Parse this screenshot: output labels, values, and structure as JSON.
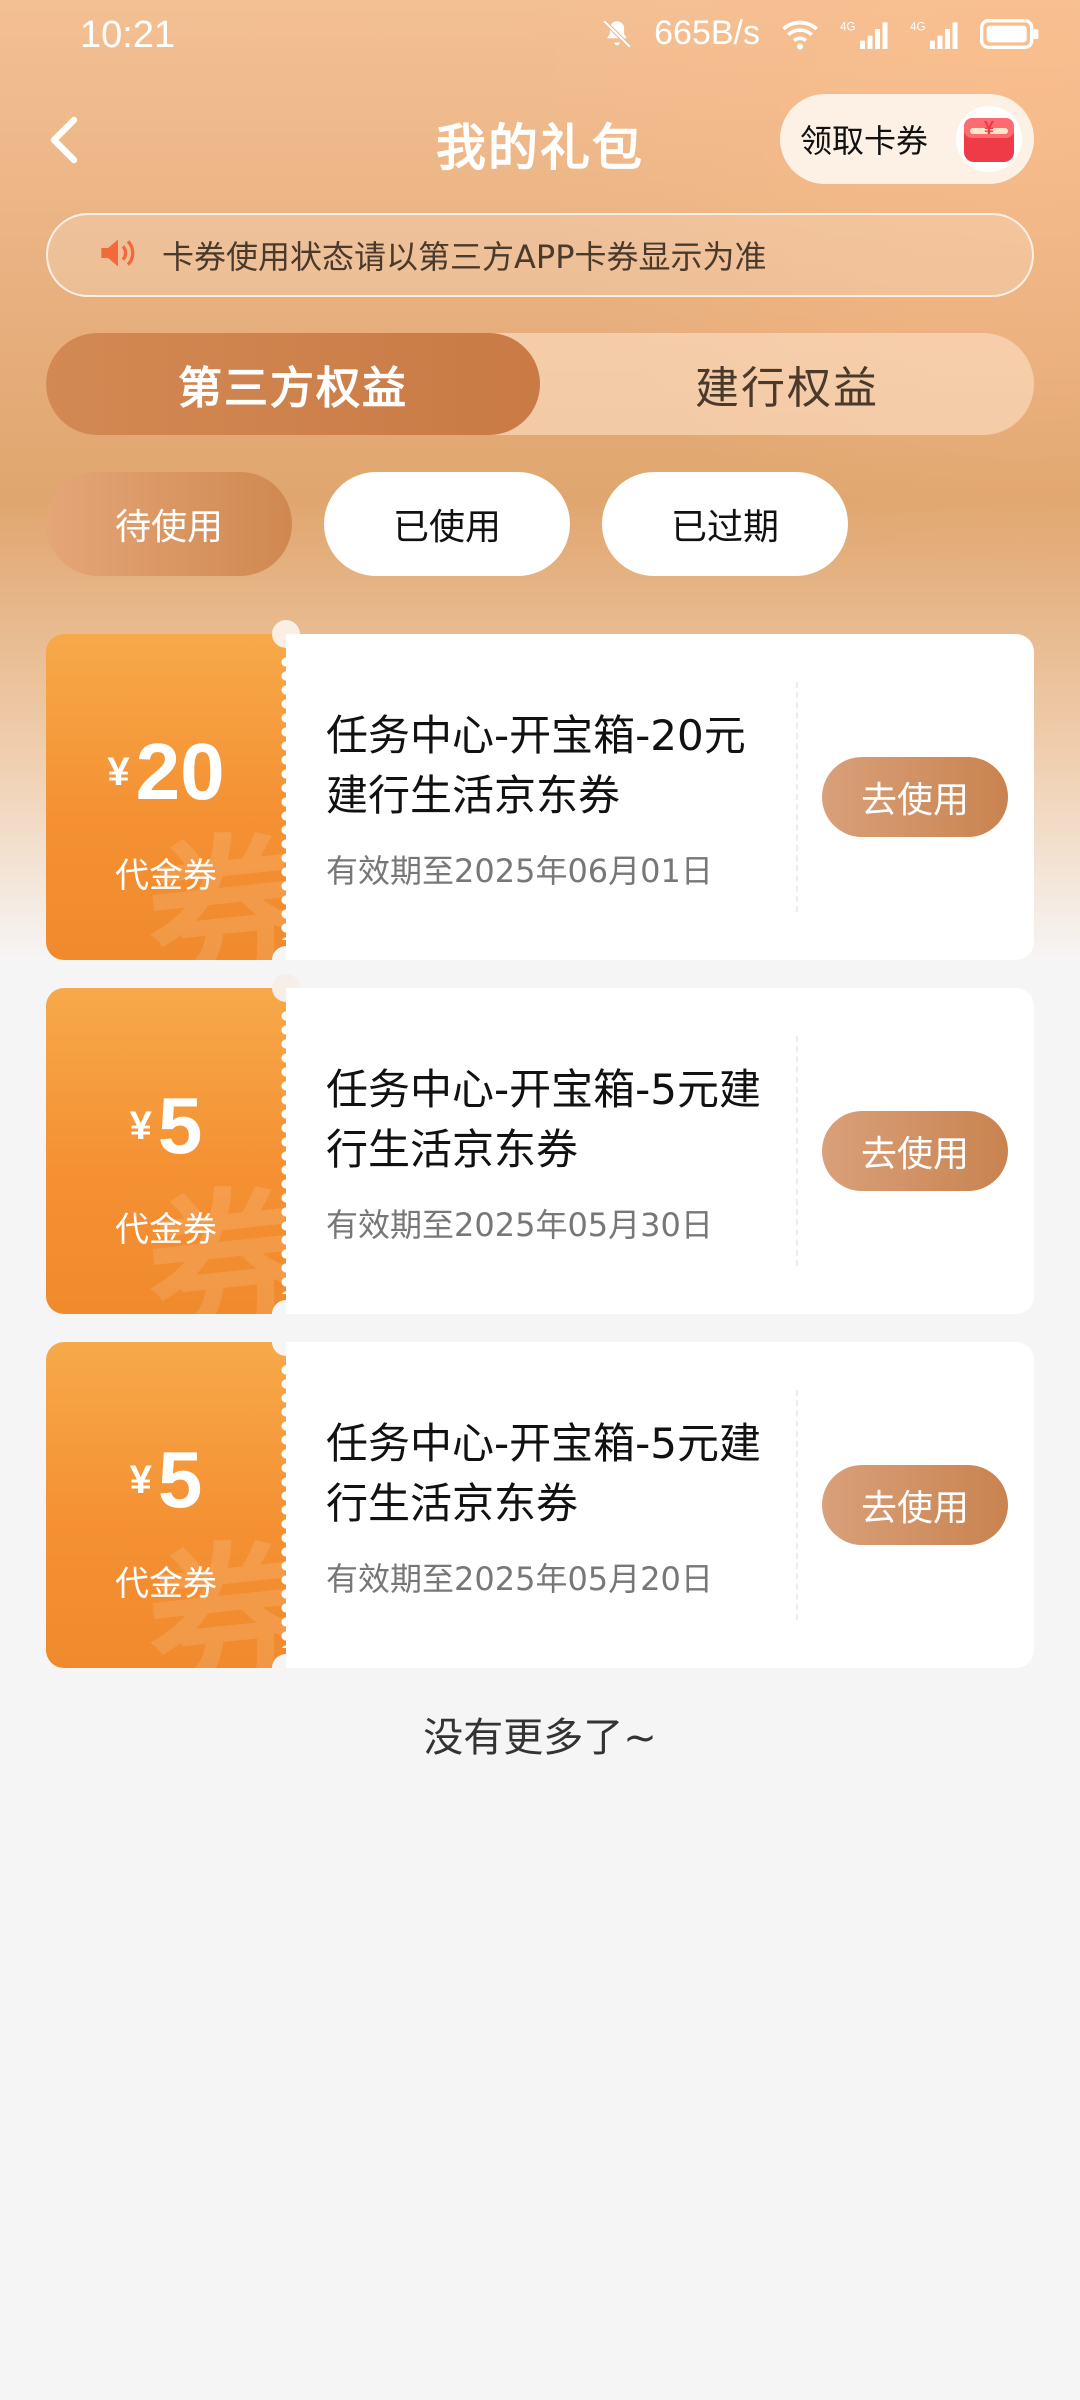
{
  "status_bar": {
    "time": "10:21",
    "speed": "665B/s"
  },
  "header": {
    "title": "我的礼包",
    "claim_label": "领取卡券",
    "claim_icon_symbol": "¥"
  },
  "notice": {
    "text": "卡券使用状态请以第三方APP卡券显示为准"
  },
  "main_tabs": [
    {
      "label": "第三方权益",
      "active": true
    },
    {
      "label": "建行权益",
      "active": false
    }
  ],
  "filters": [
    {
      "label": "待使用",
      "active": true
    },
    {
      "label": "已使用",
      "active": false
    },
    {
      "label": "已过期",
      "active": false
    }
  ],
  "coupons": [
    {
      "currency": "¥",
      "amount": "20",
      "type": "代金券",
      "title": "任务中心-开宝箱-20元建行生活京东券",
      "expiry": "有效期至2025年06月01日",
      "action": "去使用"
    },
    {
      "currency": "¥",
      "amount": "5",
      "type": "代金券",
      "title": "任务中心-开宝箱-5元建行生活京东券",
      "expiry": "有效期至2025年05月30日",
      "action": "去使用"
    },
    {
      "currency": "¥",
      "amount": "5",
      "type": "代金券",
      "title": "任务中心-开宝箱-5元建行生活京东券",
      "expiry": "有效期至2025年05月20日",
      "action": "去使用"
    }
  ],
  "coupon_watermark": "券",
  "footer": {
    "no_more": "没有更多了~"
  },
  "colors": {
    "accent": "#cf8850",
    "coupon_orange": "#f49133"
  }
}
